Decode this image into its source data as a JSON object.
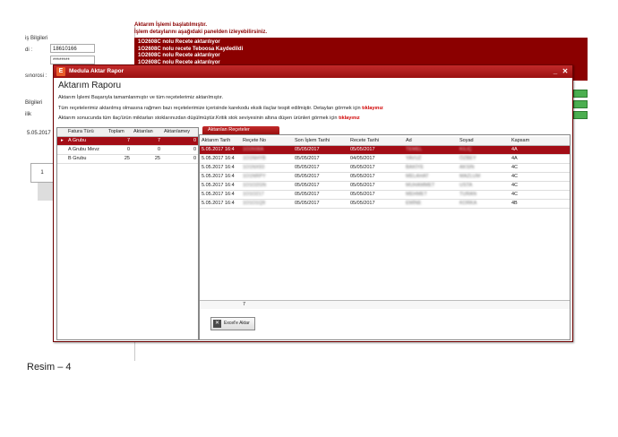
{
  "background": {
    "section_title": "iş Bilgileri",
    "tc_label": "di :",
    "tc_value": "18610166",
    "password_value": "********",
    "siparis_label": "sınorosi :",
    "bilgileri_label": "Bilgileri",
    "ilik_label": "ilik",
    "date_value": "5.05.2017",
    "tab_value": "1"
  },
  "notification": {
    "line1": "Aktarım İşlemi başlatılmıştır.",
    "line2": "İşlem detaylarını aşağıdaki panelden izleyebilirsiniz."
  },
  "log_lines": [
    "1O2608C nolu Recete aktarılıyor",
    "1O2608C nolu recete Teboosa Kaydedildi",
    "1O2608C nolu Recete aktarılıyor",
    "1O2608C nolu Recete aktarılıyor"
  ],
  "dialog": {
    "title": "Medula Aktar Rapor",
    "heading": "Aktarım Raporu",
    "info1": "Aktarım İşlemi Başarıyla tamamlanmıştır ve tüm reçetelerimiz aktarılmıştır.",
    "info2_text": "Tüm reçetelerimiz aktarılmış olmasına rağmen bazı reçetelerimize içerisinde karekodu eksik ilaçlar tespit edilmiştir. Detayları görmek için",
    "info2_link": "tıklayınız",
    "info3_text": "Aktarım sonucunda tüm ilaç/ürün miktarları stoklarınızdan düşülmüştür.Kritik stok seviyesinin altına düşen ürünleri görmek için",
    "info3_link": "tıklayınız",
    "tab_label": "Aktarılan Reçeteler",
    "excel_label": "Excel'e Aktar",
    "minimize_glyph": "_",
    "close_glyph": "✕",
    "logo_glyph": "E"
  },
  "left_table": {
    "columns": [
      "Fatura Türü",
      "Toplam",
      "Aktarılan",
      "Aktarılamey"
    ],
    "rows": [
      {
        "marker": "▸",
        "cells": [
          "A Grubu",
          "7",
          "7",
          "0"
        ]
      },
      {
        "marker": "",
        "cells": [
          "A Grubu Mevz",
          "0",
          "0",
          "0"
        ]
      },
      {
        "marker": "",
        "cells": [
          "B Grubu",
          "25",
          "25",
          "0"
        ]
      }
    ]
  },
  "grid": {
    "columns": [
      "Aktarım Tarih",
      "Reçete No",
      "Son İşlem Tarihi",
      "Recete Tarihi",
      "Ad",
      "Soyad",
      "Kapsam"
    ],
    "rows": [
      [
        "5.05.2017 16:4",
        "1O2608A",
        "05/05/2017",
        "05/05/2017",
        "TEMEL",
        "KILIÇ",
        "4A"
      ],
      [
        "5.05.2017 16:4",
        "1O1NHYB",
        "05/05/2017",
        "04/05/2017",
        "YAVUZ",
        "ÖZBEY",
        "4A"
      ],
      [
        "5.05.2017 16:4",
        "1O1NX93",
        "05/05/2017",
        "05/05/2017",
        "BAKİYE",
        "AKSIN",
        "4C"
      ],
      [
        "5.05.2017 16:4",
        "1O1NRPY",
        "05/05/2017",
        "05/05/2017",
        "MELAHAT",
        "MAZLUM",
        "4C"
      ],
      [
        "5.05.2017 16:4",
        "1O1O2GN",
        "05/05/2017",
        "05/05/2017",
        "MUHAMMET",
        "USTA",
        "4C"
      ],
      [
        "5.05.2017 16:4",
        "1O1O217",
        "05/05/2017",
        "05/05/2017",
        "MEHMET",
        "TURAN",
        "4C"
      ],
      [
        "5.05.2017 16:4",
        "1O1O1Q9",
        "05/05/2017",
        "05/05/2017",
        "EMİNE",
        "KORKA",
        "4B"
      ]
    ],
    "footer_count": "7"
  },
  "caption": "Resim – 4"
}
